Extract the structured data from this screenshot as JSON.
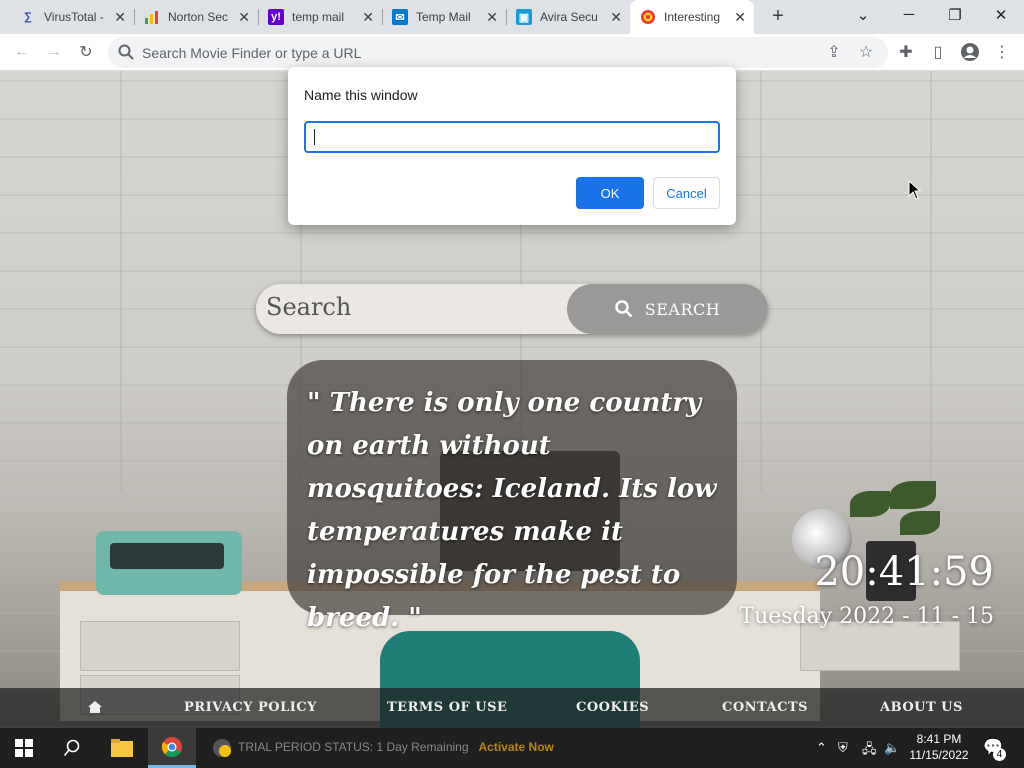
{
  "browser": {
    "tabs": [
      {
        "label": "VirusTotal -",
        "icon": "virustotal-icon",
        "color": "#3949ab",
        "active": false
      },
      {
        "label": "Norton Sec",
        "icon": "bar-chart-icon",
        "color": "#f4b400",
        "active": false
      },
      {
        "label": "temp mail",
        "icon": "yahoo-icon",
        "color": "#6001d2",
        "active": false
      },
      {
        "label": "Temp Mail",
        "icon": "mail-icon",
        "color": "#0078d4",
        "active": false
      },
      {
        "label": "Avira Secu",
        "icon": "avira-icon",
        "color": "#1a9bd7",
        "active": false
      },
      {
        "label": "Interesting",
        "icon": "target-icon",
        "color": "#e53935",
        "active": true
      }
    ],
    "address_placeholder": "Search Movie Finder or type a URL"
  },
  "dialog": {
    "title": "Name this window",
    "input_value": "",
    "ok_label": "OK",
    "cancel_label": "Cancel"
  },
  "page": {
    "search_placeholder": "Search",
    "search_button": "SEARCH",
    "quote": "\"  There is only one country on earth without mosquitoes: Iceland. Its low temperatures make it impossible for the pest to breed.  \"",
    "clock_time": "20:41:59",
    "clock_date": "Tuesday 2022 - 11 - 15",
    "footer_links": [
      "PRIVACY POLICY",
      "TERMS OF USE",
      "COOKIES",
      "CONTACTS",
      "ABOUT US"
    ]
  },
  "taskbar": {
    "activation_text": "TRIAL PERIOD STATUS: 1 Day Remaining",
    "activation_link": "Activate Now",
    "time": "8:41 PM",
    "date": "11/15/2022",
    "notification_count": "4"
  },
  "colors": {
    "accent": "#1a73e8",
    "tab_bar": "#dee1e6",
    "taskbar": "#1f1f1f"
  }
}
